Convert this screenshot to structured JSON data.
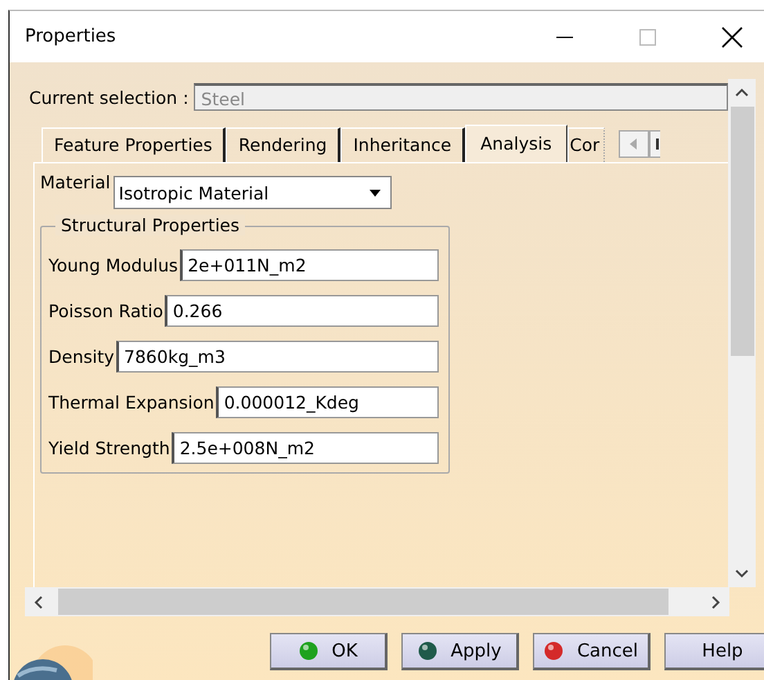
{
  "window": {
    "title": "Properties"
  },
  "current_selection": {
    "label": "Current selection :",
    "value": "Steel"
  },
  "tabs": [
    {
      "label": "Feature Properties",
      "selected": false
    },
    {
      "label": "Rendering",
      "selected": false
    },
    {
      "label": "Inheritance",
      "selected": false
    },
    {
      "label": "Analysis",
      "selected": true
    },
    {
      "label": "Cor",
      "selected": false
    }
  ],
  "material": {
    "label": "Material",
    "value": "Isotropic Material"
  },
  "structural_properties": {
    "title": "Structural Properties",
    "fields": [
      {
        "label": "Young Modulus",
        "value": "2e+011N_m2"
      },
      {
        "label": "Poisson Ratio",
        "value": "0.266"
      },
      {
        "label": "Density",
        "value": "7860kg_m3"
      },
      {
        "label": "Thermal Expansion",
        "value": "0.000012_Kdeg"
      },
      {
        "label": "Yield Strength",
        "value": "2.5e+008N_m2"
      }
    ]
  },
  "buttons": [
    {
      "label": "OK",
      "kind": "ok"
    },
    {
      "label": "Apply",
      "kind": "apply"
    },
    {
      "label": "Cancel",
      "kind": "cancel"
    },
    {
      "label": "Help",
      "kind": "help"
    }
  ]
}
